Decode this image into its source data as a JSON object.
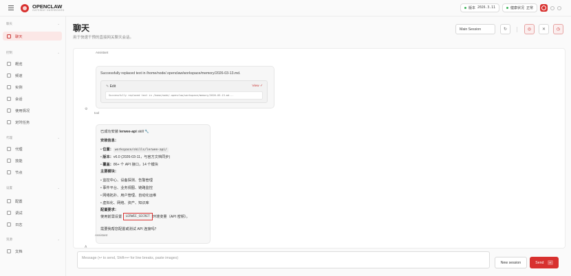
{
  "brand": {
    "name": "OPENCLAW",
    "subtitle": "GATEWAY DASHBOARD"
  },
  "topbar": {
    "version_label": "版本",
    "version_value": "2026.3.11",
    "health_label": "健康状况",
    "health_value": "正常"
  },
  "sidebar": {
    "groups": {
      "chat": "聊天",
      "control": "控制",
      "agent": "代理",
      "settings": "设置",
      "resources": "资源"
    },
    "items": {
      "chat": "聊天",
      "overview": "概览",
      "channels": "频道",
      "instances": "实例",
      "sessions": "会话",
      "usage": "使用情况",
      "cron": "定时任务",
      "agents": "代理",
      "skills": "技能",
      "nodes": "节点",
      "config": "配置",
      "debug": "调试",
      "logs": "日志",
      "docs": "文档"
    }
  },
  "page": {
    "title": "聊天",
    "subtitle": "用于快速干预的直接网关聊天会话。"
  },
  "session_select": "Main Session",
  "chat": {
    "role_assistant_top": "Assistant",
    "tool_message": "Successfully replaced text in /home/node/.openclaw/workspace/memory/2026-03-13.md.",
    "tool_card": {
      "label": "Edit",
      "view": "View ✓",
      "output": "Successfully replaced text in /home/node/.openclaw/workspace/memory/2026-03-13.md..."
    },
    "tool_role": "tool",
    "tool_avatar": "⚙",
    "msg": {
      "line1_pre": "已成功安装 ",
      "line1_bold": "lerwee-api",
      "line1_post": " skill 🔧",
      "install_title": "安装信息：",
      "loc_label": "位置：",
      "loc_value": "workspace/skills/lerwee-api/",
      "ver_label": "版本：",
      "ver_value": "v6.0 (2026-03-11，与官方文档同步)",
      "cov_label": "覆盖：",
      "cov_value": "86+ 个 API 接口，14 个模块",
      "modules_title": "主要模块：",
      "modules": [
        "监控中心、设备探测、告警管理",
        "事件平台、业务视图、链路监控",
        "网络拓扑、用户管理、自动化运维",
        "虚拟化、网络、资产、知识库"
      ],
      "config_title": "配置要求：",
      "config_pre": "使用前需设置",
      "config_code": "LERWEE_SECRET",
      "config_post": "环境变量（API 密钥）。",
      "question": "需要我帮您配置或测试 API 连接吗？"
    },
    "assistant_avatar": "A",
    "role_assistant_bottom": "Assistant"
  },
  "composer": {
    "placeholder": "Message (↩ to send, Shift+↩ for line breaks, paste images)",
    "new_session": "New session",
    "send": "Send",
    "send_key": "↵"
  },
  "colors": {
    "accent": "#d8312f",
    "active_bg": "#fbe7e6",
    "status_green": "#3db35a"
  }
}
